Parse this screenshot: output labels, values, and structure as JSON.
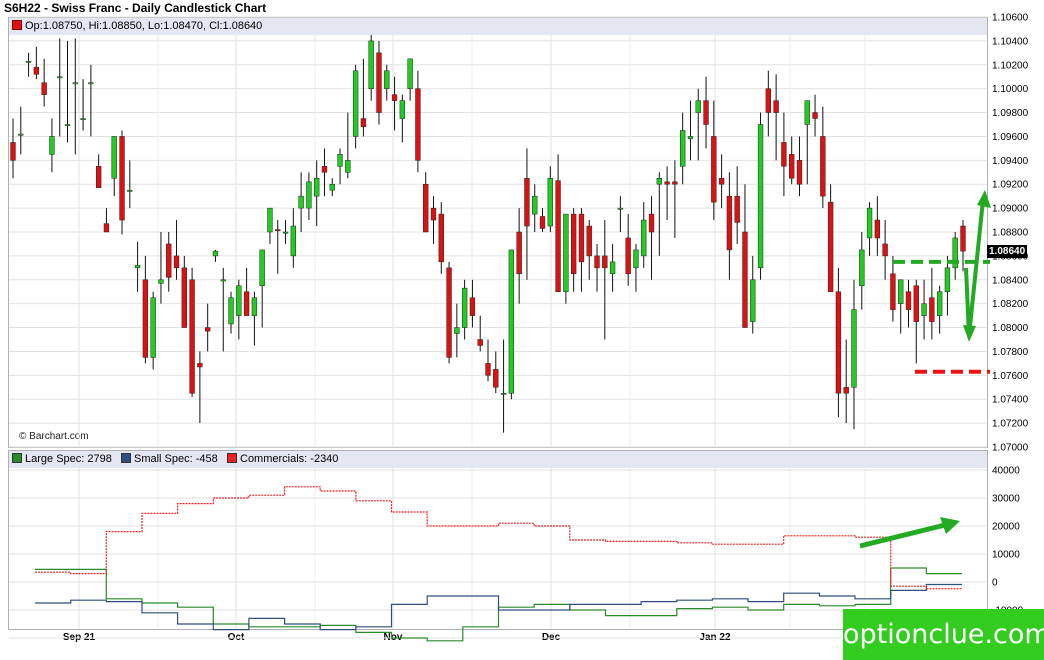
{
  "title": "S6H22 - Swiss Franc - Daily Candlestick Chart",
  "ohlc_label": "Op:1.08750, Hi:1.08850, Lo:1.08470, Cl:1.08640",
  "credit": "© Barchart.com",
  "last_price": "1.08640",
  "watermark": "optionclue.com",
  "colors": {
    "up": "#22cc22",
    "down": "#dd1111",
    "large": "#2a8a2a",
    "small": "#2f4f7f",
    "commercials": "#ee2222",
    "annotation": "#22aa22",
    "support": "#ee1111"
  },
  "chart_data": [
    {
      "type": "candlestick",
      "title": "S6H22 - Swiss Franc - Daily Candlestick Chart",
      "ylim": [
        1.07,
        1.106
      ],
      "y_ticks": [
        "1.07000",
        "1.07200",
        "1.07400",
        "1.07600",
        "1.07800",
        "1.08000",
        "1.08200",
        "1.08400",
        "1.08600",
        "1.08800",
        "1.09000",
        "1.09200",
        "1.09400",
        "1.09600",
        "1.09800",
        "1.10000",
        "1.10200",
        "1.10400",
        "1.10600"
      ],
      "x_ticks": [
        "Sep 21",
        "Oct",
        "Nov",
        "Dec",
        "Jan 22"
      ],
      "candles": [
        [
          1.0955,
          1.0975,
          1.0925,
          1.094
        ],
        [
          1.0962,
          1.0985,
          1.0945,
          1.0962
        ],
        [
          1.1023,
          1.103,
          1.101,
          1.1023
        ],
        [
          1.1018,
          1.1035,
          1.1008,
          1.1012
        ],
        [
          1.1005,
          1.1025,
          1.0985,
          1.0995
        ],
        [
          1.0945,
          1.0975,
          1.093,
          1.096
        ],
        [
          1.101,
          1.1042,
          1.096,
          1.101
        ],
        [
          1.097,
          1.104,
          1.0955,
          1.097
        ],
        [
          1.1005,
          1.1042,
          1.0945,
          1.1005
        ],
        [
          1.0975,
          1.1008,
          1.0965,
          1.0975
        ],
        [
          1.1005,
          1.102,
          1.096,
          1.1005
        ],
        [
          1.0935,
          1.0945,
          1.092,
          1.0917
        ],
        [
          1.0887,
          1.09,
          1.088,
          1.088
        ],
        [
          1.0925,
          1.096,
          1.091,
          1.096
        ],
        [
          1.096,
          1.0965,
          1.0878,
          1.089
        ],
        [
          1.0915,
          1.094,
          1.09,
          1.0915
        ],
        [
          1.085,
          1.0872,
          1.083,
          1.0852
        ],
        [
          1.084,
          1.086,
          1.077,
          1.0775
        ],
        [
          1.0775,
          1.083,
          1.0765,
          1.0825
        ],
        [
          1.0837,
          1.088,
          1.082,
          1.084
        ],
        [
          1.087,
          1.088,
          1.083,
          1.0842
        ],
        [
          1.086,
          1.089,
          1.084,
          1.085
        ],
        [
          1.085,
          1.086,
          1.08,
          1.08
        ],
        [
          1.084,
          1.085,
          1.0742,
          1.0745
        ],
        [
          1.077,
          1.078,
          1.072,
          1.0767
        ],
        [
          1.08,
          1.082,
          1.078,
          1.0797
        ],
        [
          1.086,
          1.0865,
          1.0855,
          1.0864
        ],
        [
          1.084,
          1.085,
          1.078,
          1.084
        ],
        [
          1.0803,
          1.083,
          1.0795,
          1.0825
        ],
        [
          1.081,
          1.084,
          1.079,
          1.0835
        ],
        [
          1.083,
          1.085,
          1.081,
          1.081
        ],
        [
          1.081,
          1.083,
          1.0785,
          1.0825
        ],
        [
          1.0835,
          1.0865,
          1.08,
          1.0865
        ],
        [
          1.088,
          1.09,
          1.087,
          1.09
        ],
        [
          1.0882,
          1.089,
          1.0845,
          1.0881
        ],
        [
          1.088,
          1.089,
          1.087,
          1.088
        ],
        [
          1.086,
          1.09,
          1.085,
          1.0885
        ],
        [
          1.09,
          1.093,
          1.088,
          1.091
        ],
        [
          1.09,
          1.093,
          1.089,
          1.0922
        ],
        [
          1.091,
          1.094,
          1.0885,
          1.0925
        ],
        [
          1.0935,
          1.095,
          1.091,
          1.093
        ],
        [
          1.0915,
          1.0925,
          1.091,
          1.092
        ],
        [
          1.0935,
          1.095,
          1.092,
          1.0945
        ],
        [
          1.093,
          1.098,
          1.0925,
          1.094
        ],
        [
          1.096,
          1.102,
          1.095,
          1.1015
        ],
        [
          1.0975,
          1.1025,
          1.096,
          1.0968
        ],
        [
          1.1,
          1.1045,
          1.099,
          1.104
        ],
        [
          1.103,
          1.104,
          1.097,
          1.098
        ],
        [
          1.1,
          1.102,
          1.099,
          1.1015
        ],
        [
          1.0995,
          1.101,
          1.0965,
          1.099
        ],
        [
          1.0975,
          1.0995,
          1.0955,
          1.099
        ],
        [
          1.1,
          1.102,
          1.099,
          1.1025
        ],
        [
          1.1,
          1.1015,
          1.093,
          1.094
        ],
        [
          1.092,
          1.093,
          1.088,
          1.088
        ],
        [
          1.09,
          1.091,
          1.087,
          1.089
        ],
        [
          1.0895,
          1.0905,
          1.0845,
          1.0855
        ],
        [
          1.085,
          1.0855,
          1.077,
          1.0775
        ],
        [
          1.0795,
          1.082,
          1.0775,
          1.08
        ],
        [
          1.08,
          1.084,
          1.079,
          1.0833
        ],
        [
          1.0825,
          1.084,
          1.08,
          1.081
        ],
        [
          1.079,
          1.081,
          1.078,
          1.0785
        ],
        [
          1.077,
          1.079,
          1.0755,
          1.076
        ],
        [
          1.0765,
          1.078,
          1.0745,
          1.075
        ],
        [
          1.0745,
          1.079,
          1.0712,
          1.0745
        ],
        [
          1.0745,
          1.0865,
          1.074,
          1.0865
        ],
        [
          1.088,
          1.09,
          1.082,
          1.0845
        ],
        [
          1.0925,
          1.095,
          1.084,
          1.0885
        ],
        [
          1.0895,
          1.092,
          1.088,
          1.091
        ],
        [
          1.0893,
          1.09,
          1.088,
          1.0883
        ],
        [
          1.0885,
          1.0935,
          1.088,
          1.0925
        ],
        [
          1.0923,
          1.0945,
          1.083,
          1.083
        ],
        [
          1.083,
          1.088,
          1.082,
          1.0895
        ],
        [
          1.0895,
          1.09,
          1.083,
          1.0845
        ],
        [
          1.0895,
          1.09,
          1.083,
          1.0855
        ],
        [
          1.0885,
          1.089,
          1.084,
          1.086
        ],
        [
          1.086,
          1.087,
          1.083,
          1.085
        ],
        [
          1.086,
          1.089,
          1.079,
          1.085
        ],
        [
          1.0845,
          1.087,
          1.083,
          1.0855
        ],
        [
          1.09,
          1.091,
          1.088,
          1.09
        ],
        [
          1.0875,
          1.0895,
          1.0835,
          1.0845
        ],
        [
          1.085,
          1.087,
          1.083,
          1.0865
        ],
        [
          1.086,
          1.0905,
          1.085,
          1.089
        ],
        [
          1.0895,
          1.091,
          1.084,
          1.088
        ],
        [
          1.092,
          1.093,
          1.086,
          1.0925
        ],
        [
          1.0922,
          1.0935,
          1.089,
          1.092
        ],
        [
          1.0922,
          1.094,
          1.0875,
          1.092
        ],
        [
          1.0935,
          1.098,
          1.092,
          1.0965
        ],
        [
          1.0958,
          1.099,
          1.094,
          1.096
        ],
        [
          1.098,
          1.1,
          1.094,
          1.099
        ],
        [
          1.099,
          1.101,
          1.095,
          1.097
        ],
        [
          1.096,
          1.099,
          1.089,
          1.0905
        ],
        [
          1.0925,
          1.0945,
          1.09,
          1.092
        ],
        [
          1.091,
          1.093,
          1.084,
          1.0865
        ],
        [
          1.091,
          1.0935,
          1.087,
          1.0888
        ],
        [
          1.088,
          1.092,
          1.08,
          1.08
        ],
        [
          1.0805,
          1.086,
          1.0795,
          1.084
        ],
        [
          1.085,
          1.098,
          1.084,
          1.097
        ],
        [
          1.1,
          1.1015,
          1.096,
          1.098
        ],
        [
          1.099,
          1.1012,
          1.094,
          1.098
        ],
        [
          1.0955,
          1.098,
          1.091,
          1.0935
        ],
        [
          1.0945,
          1.096,
          1.092,
          1.0925
        ],
        [
          1.094,
          1.096,
          1.091,
          1.092
        ],
        [
          1.097,
          1.099,
          1.092,
          1.099
        ],
        [
          1.098,
          1.0995,
          1.096,
          1.0975
        ],
        [
          1.096,
          1.0985,
          1.09,
          1.091
        ],
        [
          1.0905,
          1.092,
          1.083,
          1.083
        ],
        [
          1.083,
          1.085,
          1.0725,
          1.0745
        ],
        [
          1.075,
          1.079,
          1.072,
          1.0745
        ],
        [
          1.075,
          1.084,
          1.0715,
          1.0815
        ],
        [
          1.0835,
          1.088,
          1.0815,
          1.0865
        ],
        [
          1.0875,
          1.0905,
          1.086,
          1.09
        ],
        [
          1.089,
          1.091,
          1.086,
          1.0875
        ],
        [
          1.087,
          1.089,
          1.084,
          1.086
        ],
        [
          1.0845,
          1.086,
          1.0805,
          1.0815
        ],
        [
          1.082,
          1.084,
          1.0795,
          1.084
        ],
        [
          1.083,
          1.084,
          1.08,
          1.0815
        ],
        [
          1.0835,
          1.084,
          1.077,
          1.0805
        ],
        [
          1.081,
          1.084,
          1.079,
          1.082
        ],
        [
          1.0825,
          1.085,
          1.079,
          1.0805
        ],
        [
          1.081,
          1.0835,
          1.0795,
          1.083
        ],
        [
          1.083,
          1.086,
          1.081,
          1.085
        ],
        [
          1.085,
          1.088,
          1.084,
          1.0875
        ],
        [
          1.0885,
          1.089,
          1.0847,
          1.0864
        ]
      ],
      "annotations": [
        "green dashed resistance line near 1.0855",
        "red dashed support line near 1.0763",
        "green arrow up then down"
      ]
    },
    {
      "type": "step-line",
      "ylim": [
        -20000,
        40000
      ],
      "y_ticks": [
        "40000",
        "30000",
        "20000",
        "10000",
        "0",
        "-10000",
        "-20000"
      ],
      "series": [
        {
          "name": "Large Spec: 2798",
          "values": [
            4500,
            4500,
            -6000,
            -7500,
            -9000,
            -15000,
            -16000,
            -16000,
            -15500,
            -18000,
            -20000,
            -21000,
            -16000,
            -9000,
            -8000,
            -10000,
            -12000,
            -12000,
            -9500,
            -9000,
            -10000,
            -8000,
            -8500,
            -8000,
            5000,
            3000
          ]
        },
        {
          "name": "Small Spec: -458",
          "values": [
            -7500,
            -6500,
            -7000,
            -11000,
            -15000,
            -17000,
            -13000,
            -15000,
            -17000,
            -16000,
            -8000,
            -5000,
            -5000,
            -10000,
            -10000,
            -8000,
            -8000,
            -7000,
            -6500,
            -6000,
            -7000,
            -4000,
            -5000,
            -6000,
            -3000,
            -900
          ]
        },
        {
          "name": "Commercials: -2340",
          "values": [
            3500,
            3000,
            18000,
            24500,
            28000,
            30000,
            31000,
            34000,
            32500,
            29000,
            25000,
            20000,
            20000,
            21000,
            20000,
            15000,
            14500,
            14500,
            14000,
            13500,
            13500,
            16500,
            16500,
            16000,
            -1500,
            -2400
          ]
        }
      ],
      "annotations": [
        "green arrow pointing up-right"
      ]
    }
  ]
}
